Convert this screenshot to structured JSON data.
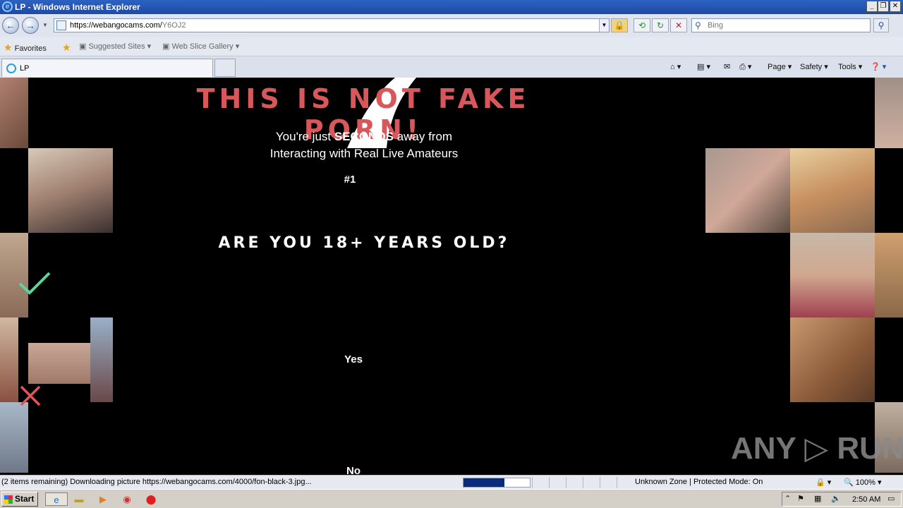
{
  "window": {
    "title": "LP - Windows Internet Explorer"
  },
  "address": {
    "host": "https://webangocams.com/",
    "path": "Y6OJ2"
  },
  "search": {
    "placeholder": "Bing"
  },
  "favorites": {
    "label": "Favorites",
    "suggested": "Suggested Sites",
    "gallery": "Web Slice Gallery"
  },
  "tab": {
    "label": "LP"
  },
  "commands": {
    "page": "Page",
    "safety": "Safety",
    "tools": "Tools"
  },
  "content": {
    "headline": "THIS IS NOT FAKE PORN!",
    "sub1_pre": "You're just ",
    "sub1_bold": "SECONDS",
    "sub1_post": " away from",
    "sub2": "Interacting with Real Live Amateurs",
    "rank": "#1",
    "question": "ARE YOU 18+ YEARS OLD?",
    "yes": "Yes",
    "no": "No",
    "watermark": "ANY ▷ RUN"
  },
  "status": {
    "text": "(2 items remaining) Downloading picture https://webangocams.com/4000/fon-black-3.jpg...",
    "progress": 0.62,
    "zone": "Unknown Zone | Protected Mode: On",
    "zoom": "100%"
  },
  "taskbar": {
    "start": "Start",
    "clock": "2:50 AM"
  },
  "colors": {
    "headline": "#d9575a",
    "check": "#5fd39a",
    "cross": "#e0545a"
  }
}
